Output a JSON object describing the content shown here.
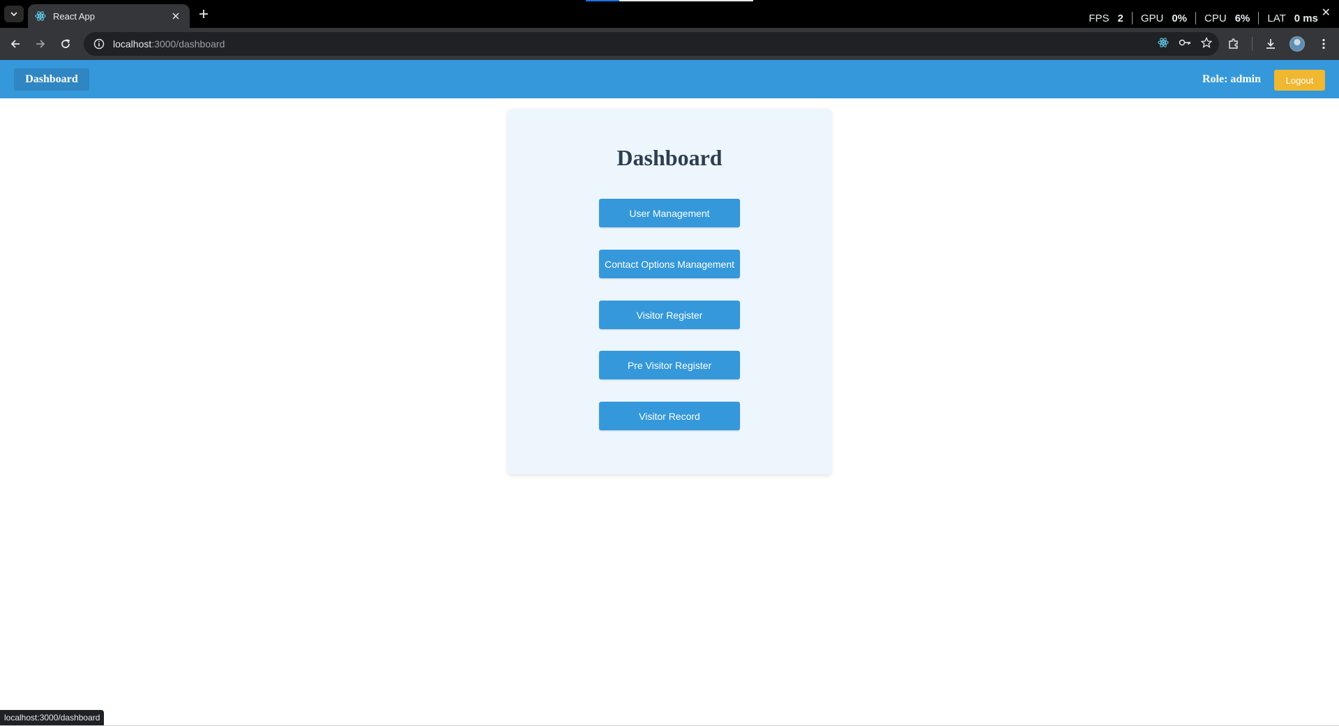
{
  "browser": {
    "tab_title": "React App",
    "url_host": "localhost",
    "url_path": ":3000/dashboard",
    "status_url": "localhost:3000/dashboard",
    "perf": [
      {
        "label": "FPS",
        "value": "2"
      },
      {
        "label": "GPU",
        "value": "0%"
      },
      {
        "label": "CPU",
        "value": "6%"
      },
      {
        "label": "LAT",
        "value": "0 ms"
      }
    ]
  },
  "header": {
    "brand": "Dashboard",
    "role": "Role: admin",
    "logout": "Logout"
  },
  "main": {
    "title": "Dashboard",
    "buttons": [
      "User Management",
      "Contact Options Management",
      "Visitor Register",
      "Pre Visitor Register",
      "Visitor Record"
    ]
  },
  "colors": {
    "header_bg": "#3498db",
    "button_bg": "#3498db",
    "logout_bg": "#f0b731",
    "card_bg": "#eef6fd",
    "title_text": "#2c3e50"
  }
}
